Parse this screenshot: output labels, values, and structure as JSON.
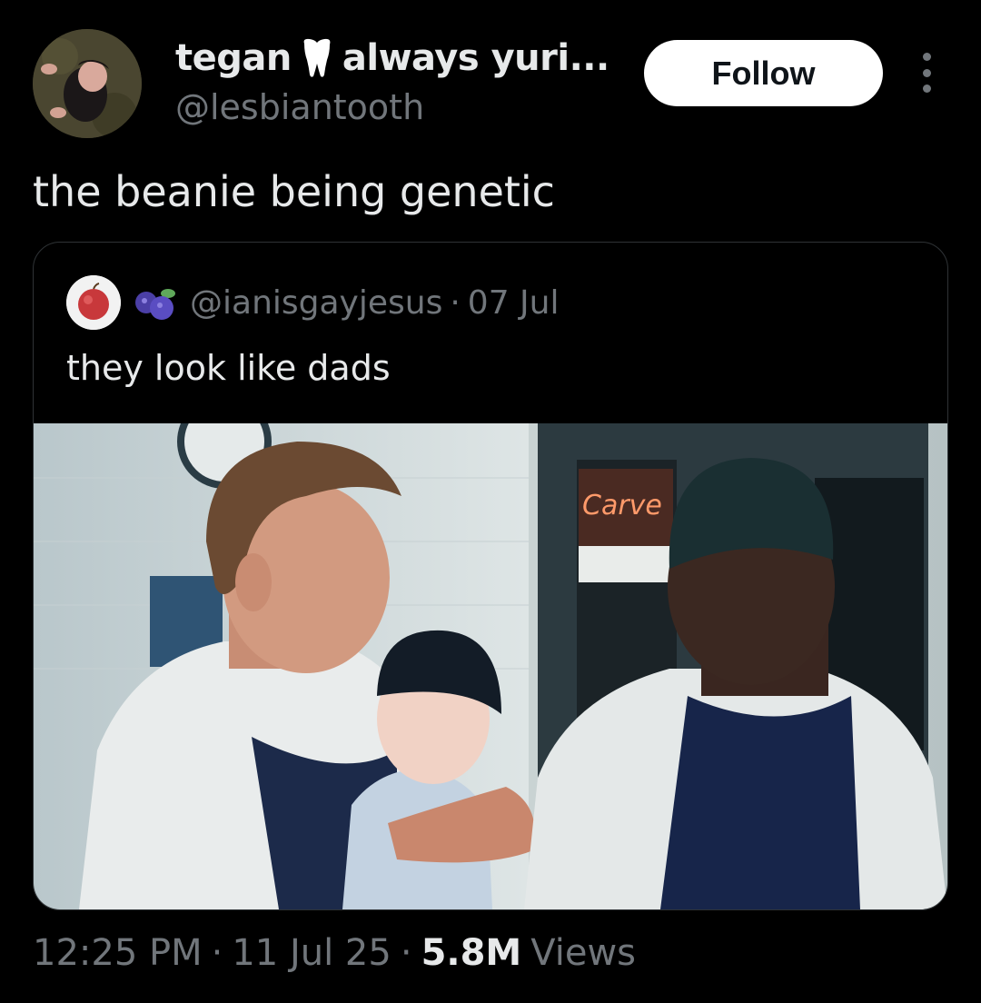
{
  "author": {
    "display_name_part1": "tegan",
    "display_name_emoji": "tooth-emoji",
    "display_name_part2": "always yuri...",
    "handle": "@lesbiantooth"
  },
  "follow_label": "Follow",
  "tweet": {
    "text": "the beanie being genetic"
  },
  "quoted_tweet": {
    "emoji": "blueberries-emoji",
    "handle": "@ianisgayjesus",
    "separator": "·",
    "date": "07 Jul",
    "text": "they look like dads",
    "image_sign_text": "Carve"
  },
  "meta": {
    "time": "12:25 PM",
    "sep1": "·",
    "date": "11 Jul 25",
    "sep2": "·",
    "views_count": "5.8M",
    "views_label": "Views"
  },
  "colors": {
    "background": "#000000",
    "primary_text": "#e7e9ea",
    "secondary_text": "#71767b",
    "border": "#2f3336",
    "follow_bg": "#ffffff"
  }
}
